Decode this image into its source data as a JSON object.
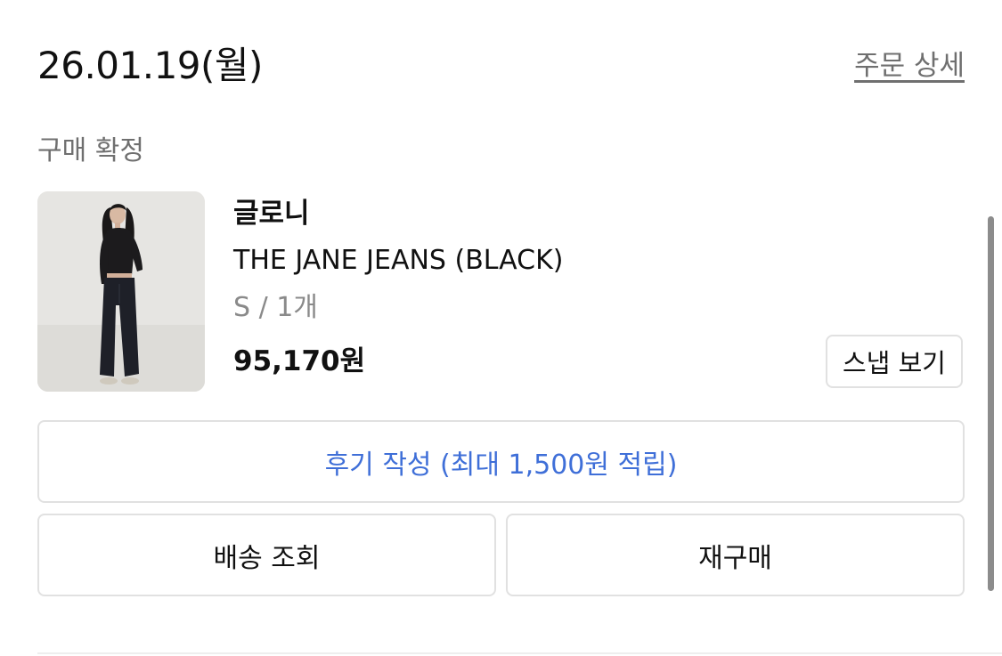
{
  "order": {
    "date": "26.01.19(월)",
    "detail_link": "주문 상세",
    "status": "구매 확정"
  },
  "product": {
    "image_icon": "product-photo",
    "brand": "글로니",
    "name": "THE JANE JEANS (BLACK)",
    "option": "S / 1개",
    "price": "95,170원",
    "snap_label": "스냅 보기"
  },
  "actions": {
    "review_label": "후기 작성 (최대 1,500원 적립)",
    "review_color": "#3f6fd8",
    "shipping_label": "배송 조회",
    "rebuy_label": "재구매"
  }
}
